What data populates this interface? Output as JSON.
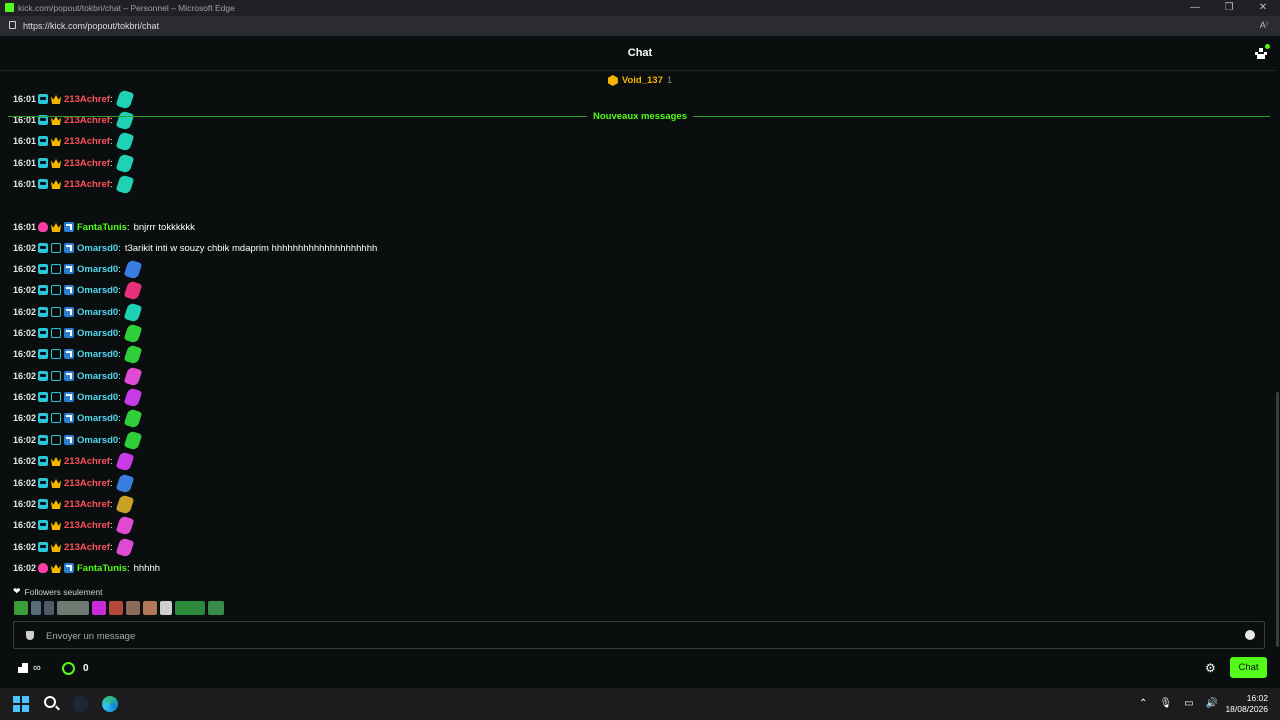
{
  "browser": {
    "window_title": "kick.com/popout/tokbri/chat – Personnel – Microsoft Edge",
    "url": "https://kick.com/popout/tokbri/chat",
    "reader_icon": "A⁾"
  },
  "header": {
    "title": "Chat"
  },
  "pinned": {
    "name": "Void_137",
    "count": "1"
  },
  "divider": {
    "label": "Nouveaux messages"
  },
  "messages": [
    {
      "time": "16:01",
      "badges": [
        "sub",
        "crown"
      ],
      "user": "213Achref",
      "color": "red",
      "text": "",
      "emote": "#1fd1b5"
    },
    {
      "time": "16:01",
      "badges": [
        "sub",
        "crown"
      ],
      "user": "213Achref",
      "color": "red",
      "text": "",
      "emote": "#1fd1b5"
    },
    {
      "time": "16:01",
      "badges": [
        "sub",
        "crown"
      ],
      "user": "213Achref",
      "color": "red",
      "text": "",
      "emote": "#1fd1b5"
    },
    {
      "time": "16:01",
      "badges": [
        "sub",
        "crown"
      ],
      "user": "213Achref",
      "color": "red",
      "text": "",
      "emote": "#1fd1b5"
    },
    {
      "time": "16:01",
      "badges": [
        "sub",
        "crown"
      ],
      "user": "213Achref",
      "color": "red",
      "text": "",
      "emote": "#1fd1b5"
    },
    {
      "time": "16:01",
      "badges": [
        "pink",
        "crown",
        "booster"
      ],
      "user": "FantaTunis",
      "color": "green",
      "text": "bnjrrr tokkkkkk",
      "emote": ""
    },
    {
      "time": "16:02",
      "badges": [
        "sub",
        "trio",
        "booster"
      ],
      "user": "Omarsd0",
      "color": "cyan",
      "text": "t3arikit inti w souzy chbik mdaprim hhhhhhhhhhhhhhhhhhhh",
      "emote": ""
    },
    {
      "time": "16:02",
      "badges": [
        "sub",
        "trio",
        "booster"
      ],
      "user": "Omarsd0",
      "color": "cyan",
      "text": "",
      "emote": "#3a7de0"
    },
    {
      "time": "16:02",
      "badges": [
        "sub",
        "trio",
        "booster"
      ],
      "user": "Omarsd0",
      "color": "cyan",
      "text": "",
      "emote": "#e8307a"
    },
    {
      "time": "16:02",
      "badges": [
        "sub",
        "trio",
        "booster"
      ],
      "user": "Omarsd0",
      "color": "cyan",
      "text": "",
      "emote": "#1fd1b5"
    },
    {
      "time": "16:02",
      "badges": [
        "sub",
        "trio",
        "booster"
      ],
      "user": "Omarsd0",
      "color": "cyan",
      "text": "",
      "emote": "#2fcf3a"
    },
    {
      "time": "16:02",
      "badges": [
        "sub",
        "trio",
        "booster"
      ],
      "user": "Omarsd0",
      "color": "cyan",
      "text": "",
      "emote": "#2fcf3a"
    },
    {
      "time": "16:02",
      "badges": [
        "sub",
        "trio",
        "booster"
      ],
      "user": "Omarsd0",
      "color": "cyan",
      "text": "",
      "emote": "#e04bd6"
    },
    {
      "time": "16:02",
      "badges": [
        "sub",
        "trio",
        "booster"
      ],
      "user": "Omarsd0",
      "color": "cyan",
      "text": "",
      "emote": "#c83be6"
    },
    {
      "time": "16:02",
      "badges": [
        "sub",
        "trio",
        "booster"
      ],
      "user": "Omarsd0",
      "color": "cyan",
      "text": "",
      "emote": "#2fcf3a"
    },
    {
      "time": "16:02",
      "badges": [
        "sub",
        "trio",
        "booster"
      ],
      "user": "Omarsd0",
      "color": "cyan",
      "text": "",
      "emote": "#2fcf3a"
    },
    {
      "time": "16:02",
      "badges": [
        "sub",
        "crown"
      ],
      "user": "213Achref",
      "color": "red",
      "text": "",
      "emote": "#c83be6"
    },
    {
      "time": "16:02",
      "badges": [
        "sub",
        "crown"
      ],
      "user": "213Achref",
      "color": "red",
      "text": "",
      "emote": "#3a7de0"
    },
    {
      "time": "16:02",
      "badges": [
        "sub",
        "crown"
      ],
      "user": "213Achref",
      "color": "red",
      "text": "",
      "emote": "#c9a227"
    },
    {
      "time": "16:02",
      "badges": [
        "sub",
        "crown"
      ],
      "user": "213Achref",
      "color": "red",
      "text": "",
      "emote": "#e04bd6"
    },
    {
      "time": "16:02",
      "badges": [
        "sub",
        "crown"
      ],
      "user": "213Achref",
      "color": "red",
      "text": "",
      "emote": "#e04bd6"
    },
    {
      "time": "16:02",
      "badges": [
        "pink",
        "crown",
        "booster"
      ],
      "user": "FantaTunis",
      "color": "green",
      "text": "hhhhh",
      "emote": ""
    }
  ],
  "followers_only": {
    "label": "Followers seulement"
  },
  "emote_bar": [
    "#3a9d3a",
    "#5a6b7a",
    "#4b5a66",
    "#6d7a72",
    "#c92bd6",
    "#b34a3a",
    "#8a6a5a",
    "#b07a5a",
    "#cfcfcf",
    "#2a8a3a",
    "#3a8a4a"
  ],
  "input": {
    "placeholder": "Envoyer un message"
  },
  "bottom": {
    "infinity": "∞",
    "points": "0",
    "send_label": "Chat"
  },
  "taskbar": {
    "time": "16:02",
    "date": "18/08/2026"
  },
  "colors": {
    "accent": "#53fc18",
    "red_user": "#ff4f5a",
    "cyan_user": "#4fd8ee",
    "green_user": "#53fc18",
    "background": "#0b0e0f"
  }
}
